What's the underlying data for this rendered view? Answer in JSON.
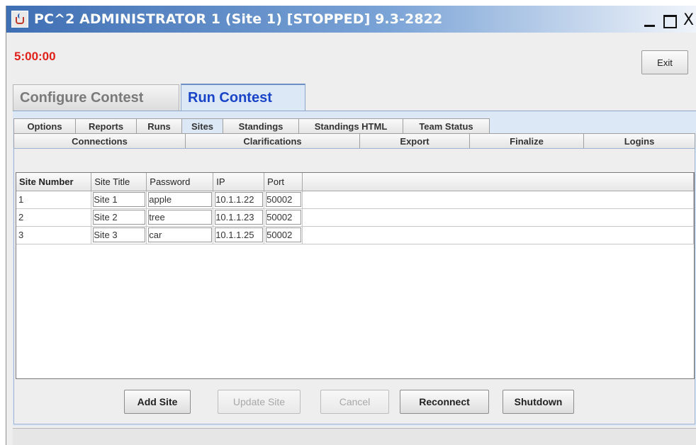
{
  "window": {
    "title": "PC^2 ADMINISTRATOR 1 (Site 1) [STOPPED] 9.3-2822",
    "minimize_glyph": "_",
    "close_glyph": "X"
  },
  "header": {
    "clock": "5:00:00",
    "exit_label": "Exit"
  },
  "main_tabs": [
    {
      "label": "Configure Contest",
      "selected": false
    },
    {
      "label": "Run Contest",
      "selected": true
    }
  ],
  "subtabs_row1": [
    {
      "label": "Options"
    },
    {
      "label": "Reports"
    },
    {
      "label": "Runs"
    },
    {
      "label": "Sites",
      "selected": true
    },
    {
      "label": "Standings"
    },
    {
      "label": "Standings HTML"
    },
    {
      "label": "Team Status"
    }
  ],
  "subtabs_row2": [
    {
      "label": "Connections"
    },
    {
      "label": "Clarifications"
    },
    {
      "label": "Export"
    },
    {
      "label": "Finalize"
    },
    {
      "label": "Logins"
    }
  ],
  "sites_table": {
    "columns": [
      "Site Number",
      "Site Title",
      "Password",
      "IP",
      "Port"
    ],
    "rows": [
      [
        "1",
        "Site 1",
        "apple",
        "10.1.1.22",
        "50002"
      ],
      [
        "2",
        "Site 2",
        "tree",
        "10.1.1.23",
        "50002"
      ],
      [
        "3",
        "Site 3",
        "car",
        "10.1.1.25",
        "50002"
      ]
    ]
  },
  "buttons": {
    "add_site": "Add Site",
    "update_site": "Update Site",
    "cancel": "Cancel",
    "reconnect": "Reconnect",
    "shutdown": "Shutdown"
  },
  "icons": {
    "app": "java-cup-icon"
  }
}
